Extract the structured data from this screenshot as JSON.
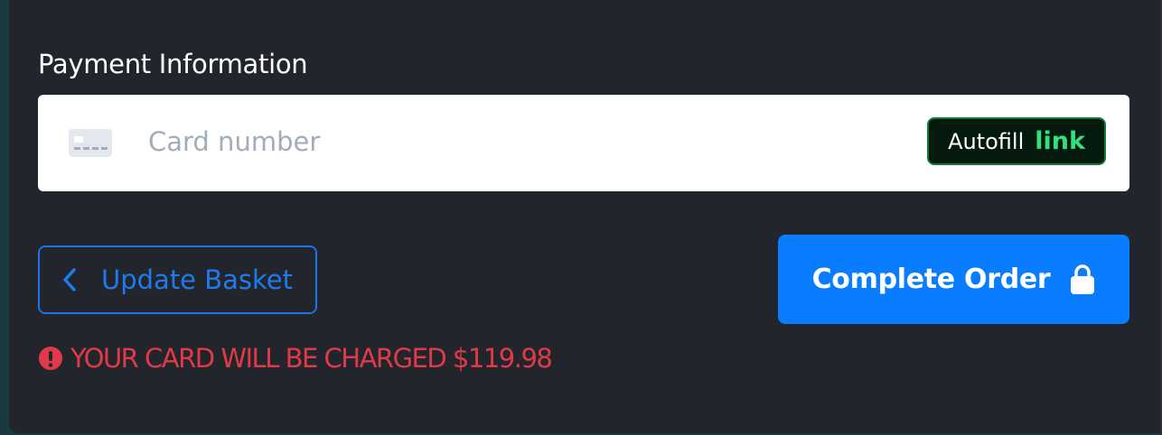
{
  "payment": {
    "title": "Payment Information",
    "card_placeholder": "Card number",
    "autofill_label": "Autofill",
    "autofill_link": "link"
  },
  "actions": {
    "update_label": "Update Basket",
    "complete_label": "Complete Order"
  },
  "warning": {
    "text": "YOUR CARD WILL BE CHARGED $119.98"
  },
  "icons": {
    "card": "credit-card-icon",
    "back": "chevron-left-icon",
    "lock": "lock-icon",
    "warning": "exclamation-circle-icon"
  },
  "colors": {
    "background": "#22252b",
    "primary": "#0a7cff",
    "outline": "#1a73e8",
    "link_green": "#33e07a",
    "warning_red": "#e03a48"
  }
}
